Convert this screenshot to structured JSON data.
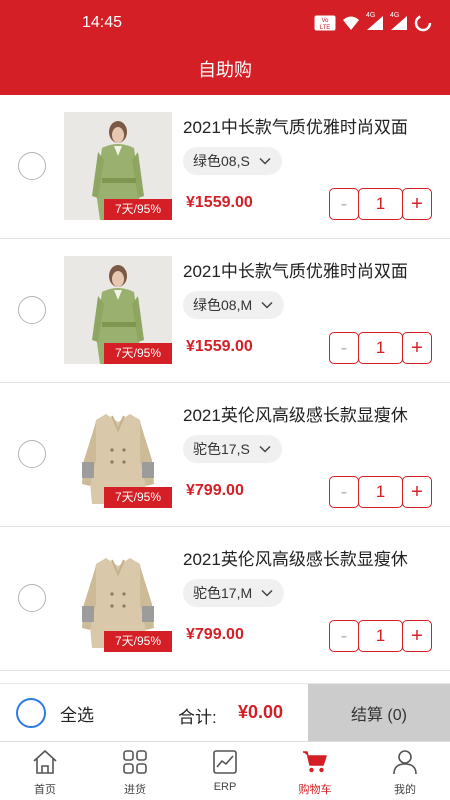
{
  "status_bar": {
    "time": "14:45",
    "net_label_1": "4G",
    "net_label_2": "4G"
  },
  "header": {
    "title": "自助购"
  },
  "accent_color": "#d31f25",
  "cart": {
    "items": [
      {
        "image": "green-coat",
        "badge": "7天/95%",
        "title": "2021中长款气质优雅时尚双面",
        "spec": "绿色08,S",
        "price": "¥1559.00",
        "quantity": "1",
        "selected": false
      },
      {
        "image": "green-coat",
        "badge": "7天/95%",
        "title": "2021中长款气质优雅时尚双面",
        "spec": "绿色08,M",
        "price": "¥1559.00",
        "quantity": "1",
        "selected": false
      },
      {
        "image": "camel-trench",
        "badge": "7天/95%",
        "title": "2021英伦风高级感长款显瘦休",
        "spec": "驼色17,S",
        "price": "¥799.00",
        "quantity": "1",
        "selected": false
      },
      {
        "image": "camel-trench",
        "badge": "7天/95%",
        "title": "2021英伦风高级感长款显瘦休",
        "spec": "驼色17,M",
        "price": "¥799.00",
        "quantity": "1",
        "selected": false
      }
    ],
    "minus_label": "-",
    "plus_label": "+"
  },
  "checkout": {
    "select_all_label": "全选",
    "total_label": "合计:",
    "total_value": "¥0.00",
    "button_label": "结算 (0)"
  },
  "tabs": [
    {
      "label": "首页",
      "icon": "home-icon",
      "active": false
    },
    {
      "label": "进货",
      "icon": "grid-icon",
      "active": false
    },
    {
      "label": "ERP",
      "icon": "chart-icon",
      "active": false
    },
    {
      "label": "购物车",
      "icon": "cart-icon",
      "active": true
    },
    {
      "label": "我的",
      "icon": "person-icon",
      "active": false
    }
  ]
}
